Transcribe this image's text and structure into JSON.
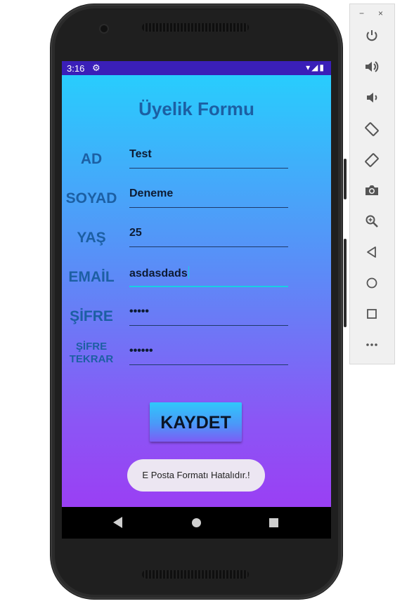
{
  "statusbar": {
    "time": "3:16",
    "settings_icon": "gear-icon",
    "icons": "▾◢▮"
  },
  "form": {
    "title": "Üyelik Formu",
    "fields": [
      {
        "label": "AD",
        "value": "Test"
      },
      {
        "label": "SOYAD",
        "value": "Deneme"
      },
      {
        "label": "YAŞ",
        "value": "25"
      },
      {
        "label": "EMAİL",
        "value": "asdasdads"
      },
      {
        "label": "ŞİFRE",
        "value": "•••••"
      },
      {
        "label_line1": "ŞİFRE",
        "label_line2": "TEKRAR",
        "value": "••••••"
      }
    ],
    "save_label": "KAYDET"
  },
  "toast": {
    "message": "E Posta Formatı Hatalıdır.!"
  },
  "emulator_panel": {
    "minimize": "−",
    "close": "×",
    "tools": [
      "power-icon",
      "volume-up-icon",
      "volume-down-icon",
      "rotate-left-icon",
      "rotate-right-icon",
      "camera-icon",
      "zoom-icon",
      "back-icon",
      "home-icon",
      "overview-icon",
      "more-icon"
    ]
  },
  "colors": {
    "status_bar": "#3a1fb8",
    "gradient_top": "#28cdfd",
    "gradient_bottom": "#9a3ff4",
    "label": "#1c5fa3",
    "active_underline": "#18d0e2"
  }
}
